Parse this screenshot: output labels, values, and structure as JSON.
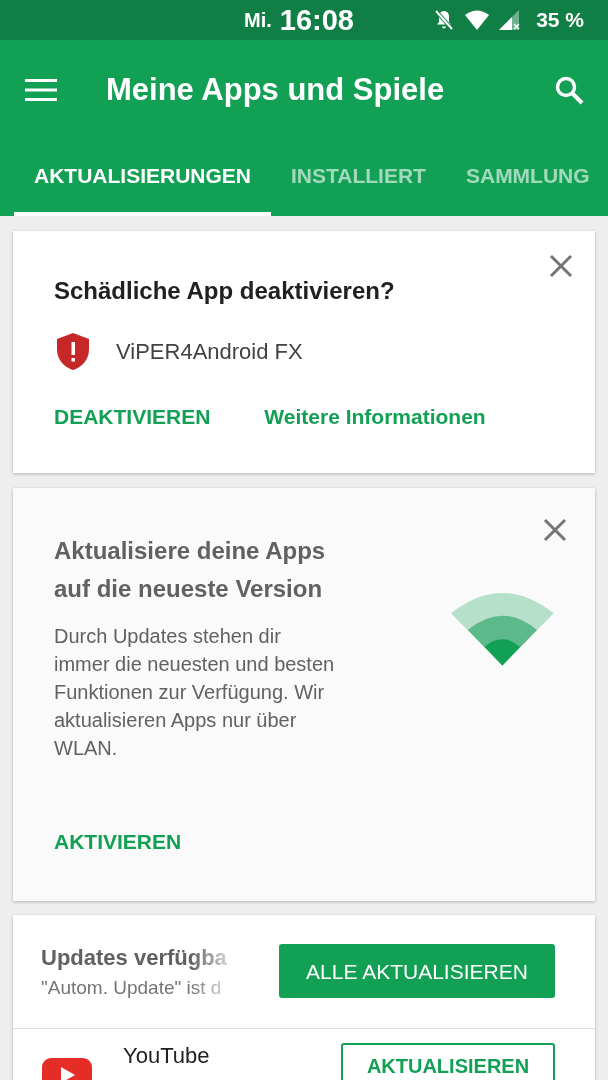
{
  "status_bar": {
    "day": "Mi.",
    "time": "16:08",
    "battery": "35 %"
  },
  "app_bar": {
    "title": "Meine Apps und Spiele"
  },
  "tabs": [
    {
      "label": "AKTUALISIERUNGEN",
      "selected": true
    },
    {
      "label": "INSTALLIERT",
      "selected": false
    },
    {
      "label": "SAMMLUNG",
      "selected": false
    }
  ],
  "harmful_app_card": {
    "title": "Schädliche App deaktivieren?",
    "app_name": "ViPER4Android FX",
    "actions": [
      "DEAKTIVIEREN",
      "Weitere Informationen"
    ]
  },
  "auto_update_card": {
    "title_lines": [
      "Aktualisiere deine Apps",
      "auf die neueste Version"
    ],
    "body": "Durch Updates stehen dir immer die neuesten und besten Funktionen zur Verfügung. Wir aktualisieren Apps nur über WLAN.",
    "action": "AKTIVIEREN"
  },
  "updates_card": {
    "title": "Updates verfügba",
    "subtitle": "\"Autom. Update\" ist d",
    "update_all_button": "ALLE AKTUALISIEREN",
    "apps": [
      {
        "name": "YouTube",
        "button": "AKTUALISIEREN"
      }
    ]
  }
}
